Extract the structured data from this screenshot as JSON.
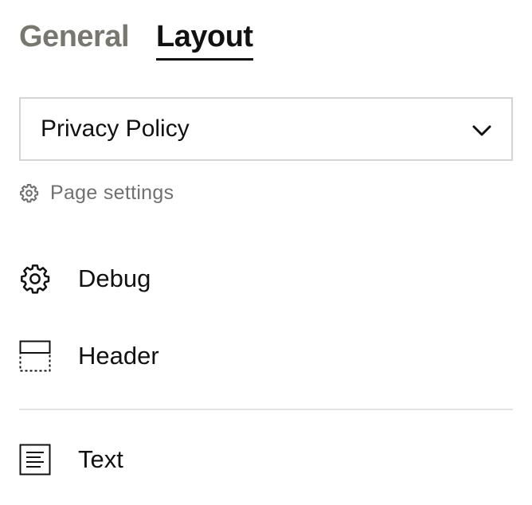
{
  "tabs": [
    {
      "label": "General",
      "active": false
    },
    {
      "label": "Layout",
      "active": true
    }
  ],
  "page_select": {
    "value": "Privacy Policy",
    "icon": "chevron-down-icon"
  },
  "page_settings": {
    "label": "Page settings",
    "icon": "gear-icon"
  },
  "items": [
    {
      "label": "Debug",
      "icon": "gear-icon"
    },
    {
      "label": "Header",
      "icon": "header-layout-icon"
    },
    {
      "label": "Text",
      "icon": "text-block-icon"
    }
  ],
  "colors": {
    "text": "#111111",
    "muted": "#707070",
    "inactive_tab": "#777770",
    "border": "#d4d4d4",
    "divider": "#e2e2e2"
  }
}
